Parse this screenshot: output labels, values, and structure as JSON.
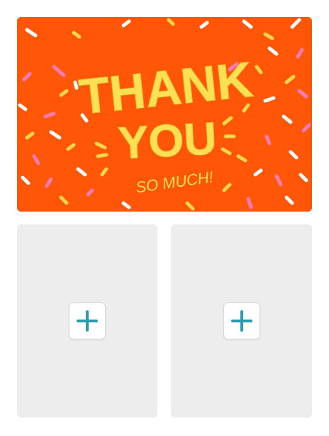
{
  "card": {
    "line1": "THANK",
    "line2": "YOU",
    "line3": "SO MUCH!",
    "background_color": "#FF5607",
    "text_color": "#FFE053",
    "confetti_colors": [
      "#FFFFFF",
      "#FF7CB7",
      "#FFD64A"
    ]
  },
  "slots": [
    {
      "icon": "plus-icon",
      "label": "add"
    },
    {
      "icon": "plus-icon",
      "label": "add"
    }
  ],
  "colors": {
    "slot_background": "#EDEDED",
    "plus_color": "#2A9CAE"
  }
}
